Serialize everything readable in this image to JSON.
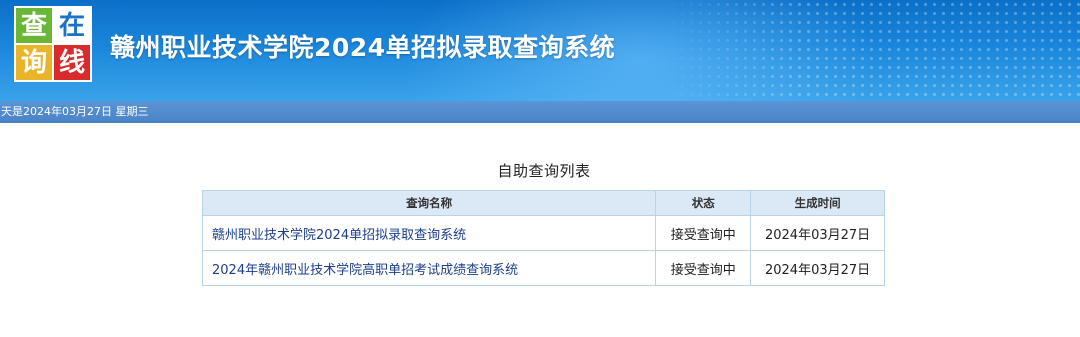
{
  "banner": {
    "logo": [
      "查",
      "在",
      "询",
      "线"
    ],
    "title": "赣州职业技术学院2024单招拟录取查询系统"
  },
  "date_bar": {
    "text": "天是2024年03月27日 星期三"
  },
  "list_title": "自助查询列表",
  "table": {
    "headers": [
      "查询名称",
      "状态",
      "生成时间"
    ],
    "rows": [
      {
        "name": "赣州职业技术学院2024单招拟录取查询系统",
        "status": "接受查询中",
        "time": "2024年03月27日"
      },
      {
        "name": "2024年赣州职业技术学院高职单招考试成绩查询系统",
        "status": "接受查询中",
        "time": "2024年03月27日"
      }
    ]
  },
  "colors": {
    "banner_blue": "#1a86db",
    "date_bar": "#4a82c6",
    "header_bg": "#dbe9f7",
    "link": "#1c3f8c"
  }
}
